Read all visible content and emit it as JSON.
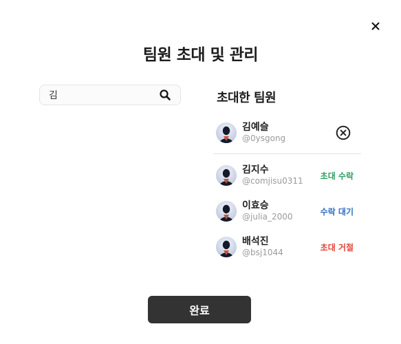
{
  "dialog": {
    "title": "팀원 초대 및 관리",
    "close_icon": "close-icon"
  },
  "search": {
    "value": "김",
    "placeholder": "",
    "icon": "search-icon"
  },
  "invited": {
    "title": "초대한 팀원",
    "selected": {
      "name": "김예슬",
      "handle": "@0ysgong",
      "remove_icon": "circle-x-icon"
    },
    "members": [
      {
        "name": "김지수",
        "handle": "@comjisu0311",
        "status": "초대 수락",
        "status_color": "#2e9e62"
      },
      {
        "name": "이효승",
        "handle": "@julia_2000",
        "status": "수락 대기",
        "status_color": "#2f6fc8"
      },
      {
        "name": "배석진",
        "handle": "@bsj1044",
        "status": "초대 거절",
        "status_color": "#e0443a"
      }
    ]
  },
  "footer": {
    "done_label": "완료"
  },
  "colors": {
    "primary_button": "#333333",
    "accepted": "#2e9e62",
    "pending": "#2f6fc8",
    "rejected": "#e0443a"
  }
}
